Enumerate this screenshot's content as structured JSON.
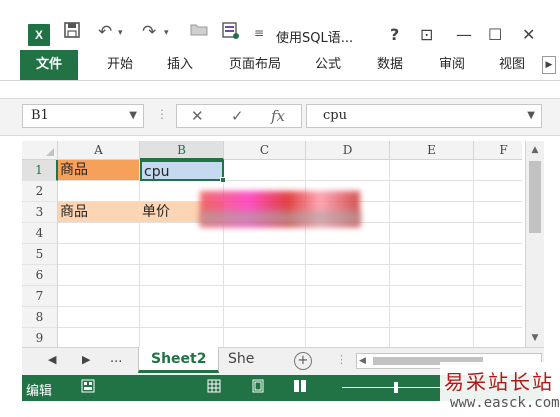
{
  "title_bar": {
    "logo_text": "X",
    "title": "使用SQL语...",
    "help": "?",
    "ribbon_display": "⊡",
    "minimize": "—",
    "maximize": "☐",
    "close": "✕"
  },
  "ribbon": {
    "tabs": [
      "文件",
      "开始",
      "插入",
      "页面布局",
      "公式",
      "数据",
      "审阅",
      "视图"
    ],
    "more": "▶"
  },
  "formula_bar": {
    "name_box": "B1",
    "cancel": "✕",
    "enter": "✓",
    "fx": "fx",
    "formula": "cpu"
  },
  "grid": {
    "columns": [
      "A",
      "B",
      "C",
      "D",
      "E",
      "F"
    ],
    "rows": [
      "1",
      "2",
      "3",
      "4",
      "5",
      "6",
      "7",
      "8",
      "9"
    ],
    "selected_cell": "B1",
    "cells": {
      "A1": "商品",
      "B1": "cpu",
      "A3": "商品",
      "B3": "单价"
    },
    "colors": {
      "A1": "#f6a05a",
      "B1": "#c5d9f1",
      "A3": "#fcd5b4",
      "B3": "#fcd5b4"
    }
  },
  "sheets": {
    "nav_prev": "◀",
    "nav_next": "▶",
    "nav_more": "...",
    "active": "Sheet2",
    "other": "She",
    "add": "+"
  },
  "status_bar": {
    "mode": "编辑"
  },
  "watermark": {
    "cn": "易采站长站",
    "en": "www.easck.com"
  },
  "accent_color": "#217346"
}
